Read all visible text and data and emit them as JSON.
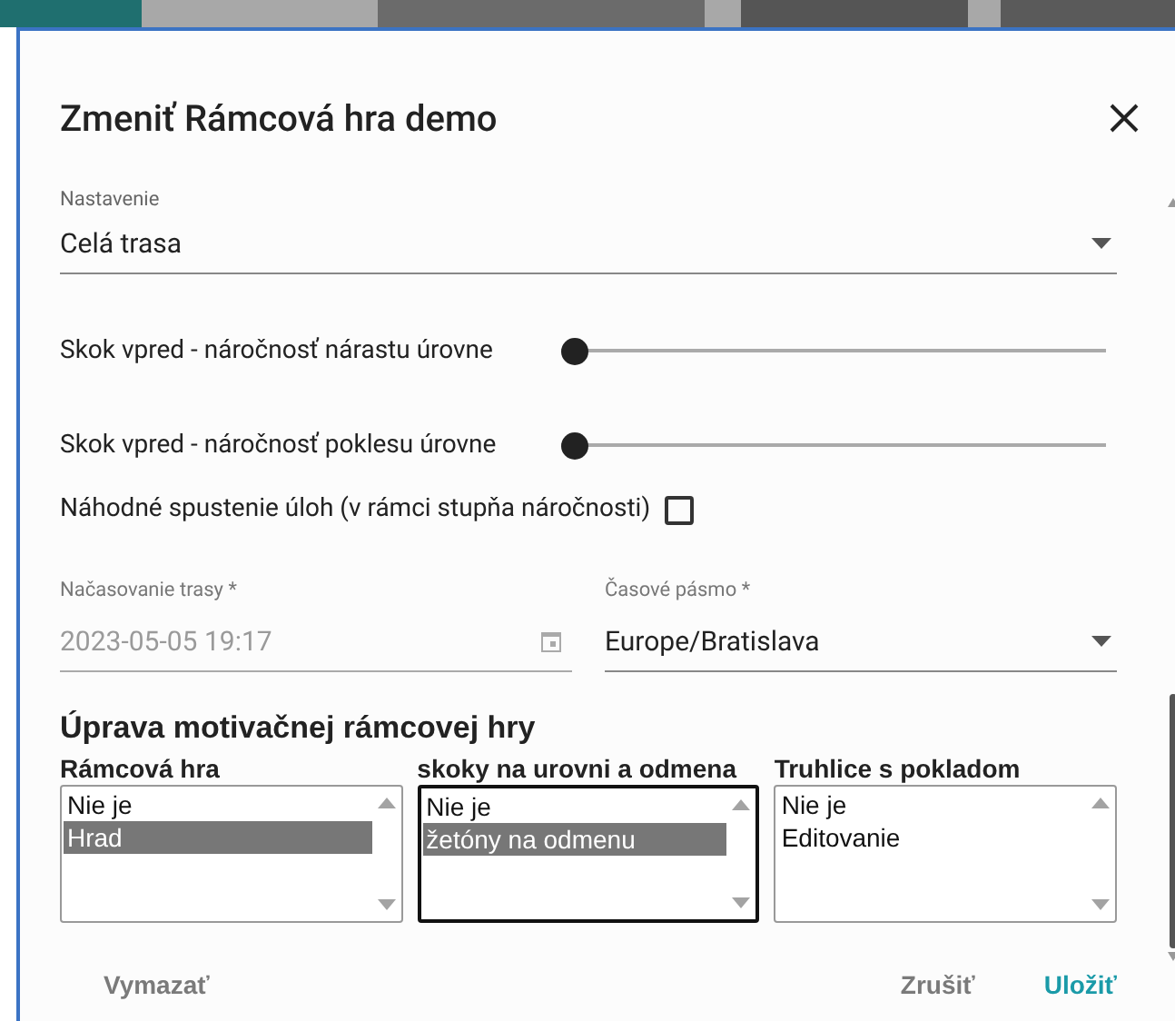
{
  "dialog": {
    "title": "Zmeniť Rámcová hra demo",
    "setting": {
      "label": "Nastavenie",
      "value": "Celá trasa"
    },
    "sliders": [
      {
        "label": "Skok vpred - náročnosť nárastu úrovne",
        "level": 0
      },
      {
        "label": "Skok vpred - náročnosť poklesu úrovne",
        "level": 0
      }
    ],
    "checkbox": {
      "label": "Náhodné spustenie úloh (v rámci stupňa náročnosti)",
      "checked": false
    },
    "schedule": {
      "label": "Načasovanie trasy *",
      "value": "2023-05-05 19:17",
      "disabled": true
    },
    "timezone": {
      "label": "Časové pásmo *",
      "value": "Europe/Bratislava"
    },
    "section_title": "Úprava motivačnej rámcovej hry",
    "lists": [
      {
        "label": "Rámcová hra",
        "focused": false,
        "options": [
          {
            "text": "Nie je",
            "selected": false
          },
          {
            "text": "Hrad",
            "selected": true
          }
        ]
      },
      {
        "label": "skoky na urovni a odmena",
        "focused": true,
        "options": [
          {
            "text": "Nie je",
            "selected": false
          },
          {
            "text": "žetóny na odmenu",
            "selected": true
          }
        ]
      },
      {
        "label": "Truhlice s pokladom",
        "focused": false,
        "options": [
          {
            "text": "Nie je",
            "selected": false
          },
          {
            "text": "Editovanie",
            "selected": false
          }
        ]
      }
    ],
    "buttons": [
      {
        "label": "Vymazať",
        "kind": "muted"
      },
      {
        "label": "Zrušiť",
        "kind": "muted"
      },
      {
        "label": "Uložiť",
        "kind": "primary"
      }
    ]
  }
}
